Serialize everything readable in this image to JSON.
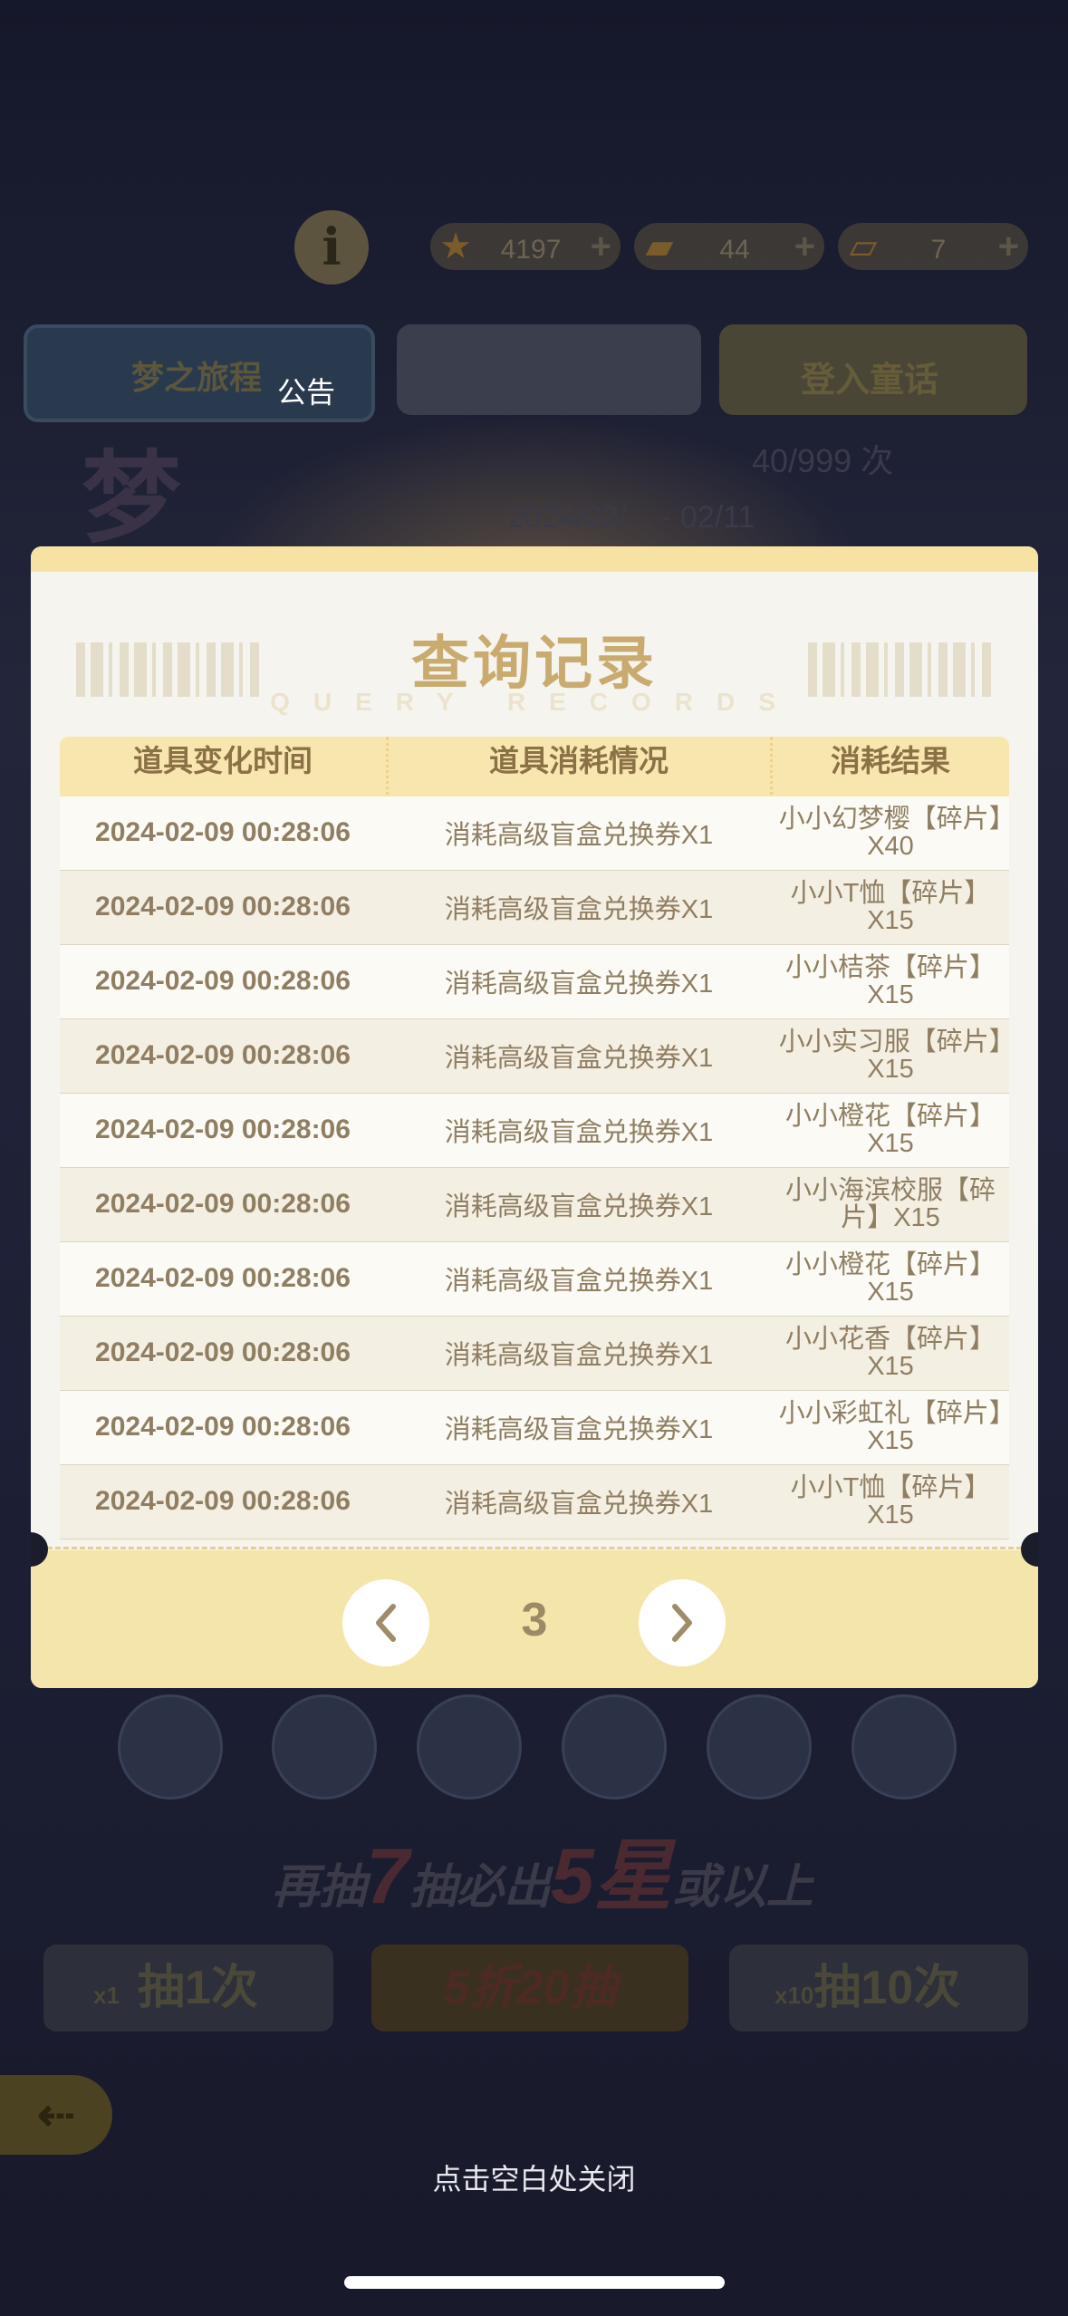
{
  "background": {
    "resources": [
      {
        "icon": "star-icon",
        "value": "4197"
      },
      {
        "icon": "ticket-icon",
        "value": "44"
      },
      {
        "icon": "coupon-icon",
        "value": "7"
      }
    ],
    "tabs": {
      "dream_tab": "梦之旅程",
      "notice": "公告",
      "right_tab": "登入童话"
    },
    "draw_count": "40/999 次",
    "date_range": "2024/02/... - 02/11",
    "pity_text": {
      "prefix": "再抽",
      "num": "7",
      "mid": "抽必出",
      "star": "5星",
      "suffix": "或以上"
    },
    "draw_buttons": {
      "one_qty": "x1",
      "one": "抽1次",
      "half": "5折20抽",
      "ten_qty": "x10",
      "ten": "抽10次"
    },
    "close_hint": "点击空白处关闭"
  },
  "modal": {
    "title": "查询记录",
    "subtitle": "QUERY RECORDS",
    "headers": [
      "道具变化时间",
      "道具消耗情况",
      "消耗结果"
    ],
    "rows": [
      [
        "2024-02-09 00:28:06",
        "消耗高级盲盒兑换券X1",
        "小小幻梦樱【碎片】X40"
      ],
      [
        "2024-02-09 00:28:06",
        "消耗高级盲盒兑换券X1",
        "小小T恤【碎片】X15"
      ],
      [
        "2024-02-09 00:28:06",
        "消耗高级盲盒兑换券X1",
        "小小桔茶【碎片】X15"
      ],
      [
        "2024-02-09 00:28:06",
        "消耗高级盲盒兑换券X1",
        "小小实习服【碎片】X15"
      ],
      [
        "2024-02-09 00:28:06",
        "消耗高级盲盒兑换券X1",
        "小小橙花【碎片】X15"
      ],
      [
        "2024-02-09 00:28:06",
        "消耗高级盲盒兑换券X1",
        "小小海滨校服【碎片】X15"
      ],
      [
        "2024-02-09 00:28:06",
        "消耗高级盲盒兑换券X1",
        "小小橙花【碎片】X15"
      ],
      [
        "2024-02-09 00:28:06",
        "消耗高级盲盒兑换券X1",
        "小小花香【碎片】X15"
      ],
      [
        "2024-02-09 00:28:06",
        "消耗高级盲盒兑换券X1",
        "小小彩虹礼【碎片】X15"
      ],
      [
        "2024-02-09 00:28:06",
        "消耗高级盲盒兑换券X1",
        "小小T恤【碎片】X15"
      ]
    ],
    "page": "3"
  }
}
